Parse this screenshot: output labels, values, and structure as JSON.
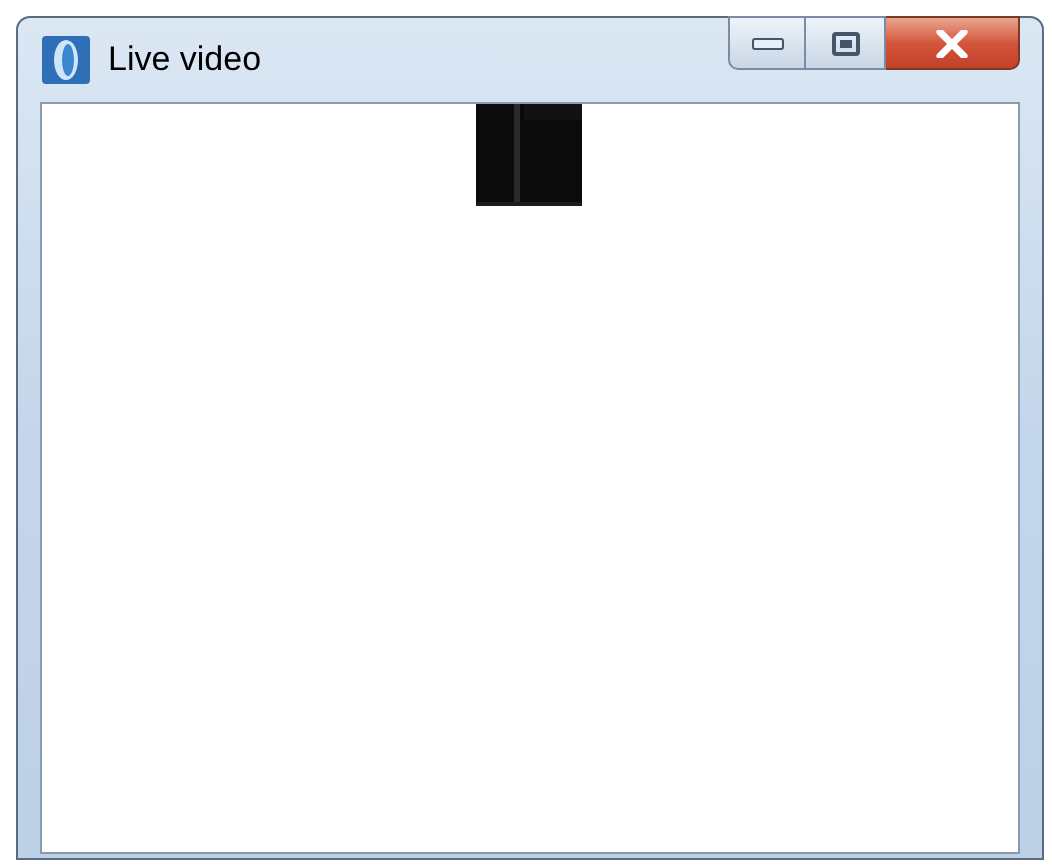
{
  "window": {
    "title": "Live video"
  }
}
